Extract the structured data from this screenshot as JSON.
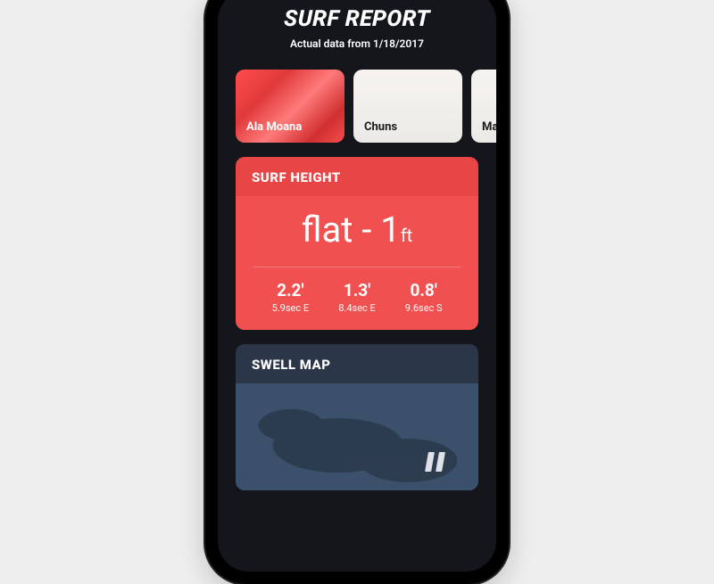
{
  "header": {
    "title": "SURF REPORT",
    "subtitle": "Actual data from 1/18/2017"
  },
  "spots": [
    {
      "name": "Ala Moana",
      "selected": true
    },
    {
      "name": "Chuns",
      "selected": false
    },
    {
      "name": "Maka",
      "selected": false
    }
  ],
  "surf_height": {
    "label": "SURF HEIGHT",
    "summary_prefix": "flat - 1",
    "summary_unit": "ft",
    "readings": [
      {
        "value": "2.2'",
        "meta": "5.9sec E"
      },
      {
        "value": "1.3'",
        "meta": "8.4sec E"
      },
      {
        "value": "0.8'",
        "meta": "9.6sec S"
      }
    ]
  },
  "swell_map": {
    "label": "SWELL MAP"
  },
  "colors": {
    "accent": "#f15050",
    "accent_dark": "#e84646",
    "map_bg": "#3a506b",
    "map_land": "#2c3a4d",
    "screen_bg": "#14161b"
  }
}
